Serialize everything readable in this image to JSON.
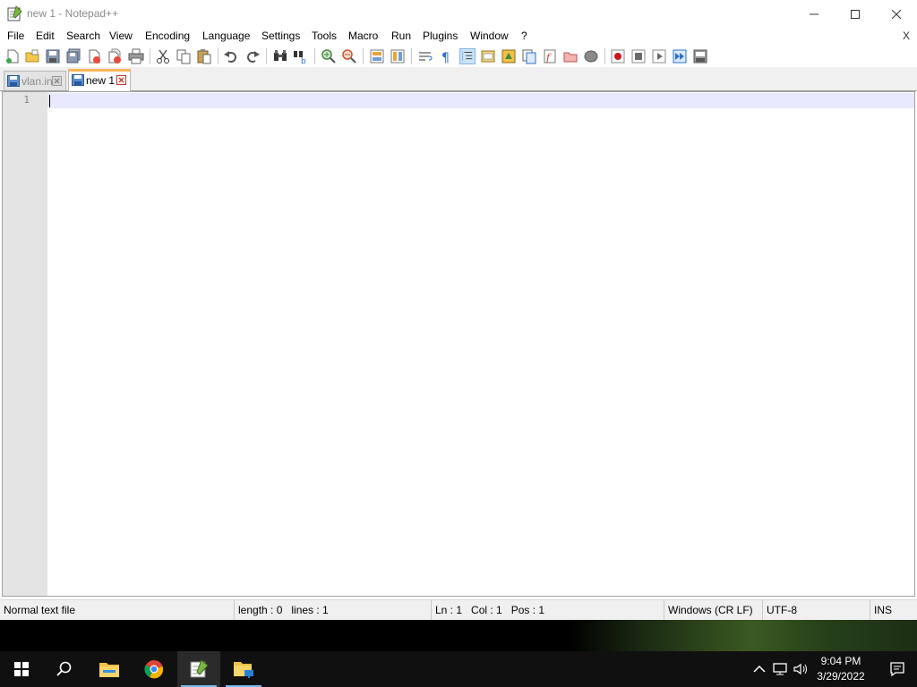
{
  "window": {
    "title": "new 1 - Notepad++"
  },
  "menu": {
    "items": [
      "File",
      "Edit",
      "Search",
      "View",
      "Encoding",
      "Language",
      "Settings",
      "Tools",
      "Macro",
      "Run",
      "Plugins",
      "Window",
      "?"
    ],
    "close_label": "X"
  },
  "toolbar": {
    "icons": [
      "new-file-icon",
      "open-file-icon",
      "save-icon",
      "save-all-icon",
      "close-icon",
      "close-all-icon",
      "print-icon",
      "cut-icon",
      "copy-icon",
      "paste-icon",
      "undo-icon",
      "redo-icon",
      "find-icon",
      "replace-icon",
      "zoom-in-icon",
      "zoom-out-icon",
      "sync-vertical-icon",
      "sync-horizontal-icon",
      "word-wrap-icon",
      "show-all-characters-icon",
      "indent-guide-icon",
      "user-defined-language-icon",
      "document-map-icon",
      "document-list-icon",
      "function-list-icon",
      "folder-as-workspace-icon",
      "monitoring-icon",
      "record-macro-icon",
      "stop-recording-icon",
      "play-macro-icon",
      "run-macro-multiple-icon",
      "save-macro-icon"
    ]
  },
  "tabs": [
    {
      "label": "vlan.ini",
      "active": false
    },
    {
      "label": "new 1",
      "active": true
    }
  ],
  "editor": {
    "line_numbers": [
      "1"
    ],
    "content": ""
  },
  "statusbar": {
    "file_type": "Normal text file",
    "length": "length : 0",
    "lines": "lines : 1",
    "ln": "Ln : 1",
    "col": "Col : 1",
    "pos": "Pos : 1",
    "eol": "Windows (CR LF)",
    "encoding": "UTF-8",
    "mode": "INS"
  },
  "taskbar": {
    "apps": [
      "start-icon",
      "search-icon",
      "file-explorer-icon",
      "chrome-icon",
      "notepadpp-icon",
      "network-folder-icon"
    ],
    "time": "9:04 PM",
    "date": "3/29/2022"
  },
  "colors": {
    "tab_accent": "#fab657",
    "current_line": "#e8e8ff",
    "gutter": "#e4e4e4",
    "taskbar": "#101010"
  }
}
